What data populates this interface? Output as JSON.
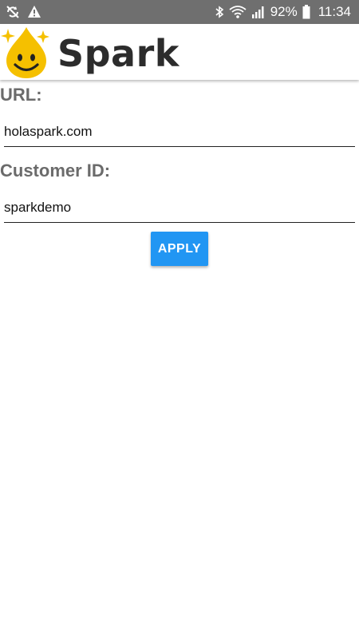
{
  "status_bar": {
    "left_icons": [
      "sync-off-icon",
      "warning-icon"
    ],
    "right_icons": [
      "bluetooth-icon",
      "wifi-icon",
      "signal-icon",
      "battery-icon"
    ],
    "battery_percent": "92%",
    "time": "11:34"
  },
  "header": {
    "title": "Spark",
    "logo_icon": "smiling-drop-icon"
  },
  "form": {
    "url_label": "URL:",
    "url_value": "holaspark.com",
    "customer_id_label": "Customer ID:",
    "customer_id_value": "sparkdemo",
    "apply_label": "APPLY"
  },
  "colors": {
    "status_bar": "#6f6f6f",
    "button": "#2196f3",
    "label_text": "#6b6b6b",
    "logo_yellow": "#f5c000"
  }
}
